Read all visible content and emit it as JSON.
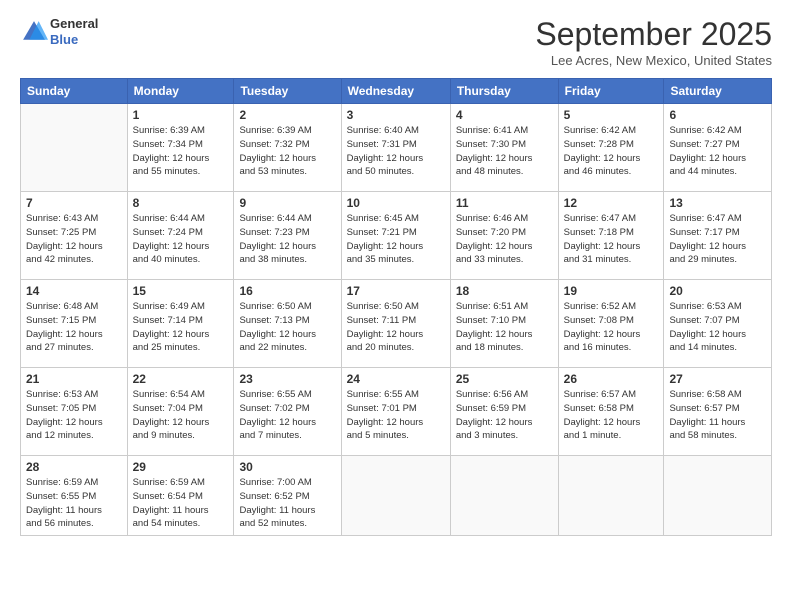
{
  "header": {
    "logo": {
      "general": "General",
      "blue": "Blue"
    },
    "title": "September 2025",
    "location": "Lee Acres, New Mexico, United States"
  },
  "weekdays": [
    "Sunday",
    "Monday",
    "Tuesday",
    "Wednesday",
    "Thursday",
    "Friday",
    "Saturday"
  ],
  "weeks": [
    [
      {
        "day": "",
        "info": ""
      },
      {
        "day": "1",
        "info": "Sunrise: 6:39 AM\nSunset: 7:34 PM\nDaylight: 12 hours\nand 55 minutes."
      },
      {
        "day": "2",
        "info": "Sunrise: 6:39 AM\nSunset: 7:32 PM\nDaylight: 12 hours\nand 53 minutes."
      },
      {
        "day": "3",
        "info": "Sunrise: 6:40 AM\nSunset: 7:31 PM\nDaylight: 12 hours\nand 50 minutes."
      },
      {
        "day": "4",
        "info": "Sunrise: 6:41 AM\nSunset: 7:30 PM\nDaylight: 12 hours\nand 48 minutes."
      },
      {
        "day": "5",
        "info": "Sunrise: 6:42 AM\nSunset: 7:28 PM\nDaylight: 12 hours\nand 46 minutes."
      },
      {
        "day": "6",
        "info": "Sunrise: 6:42 AM\nSunset: 7:27 PM\nDaylight: 12 hours\nand 44 minutes."
      }
    ],
    [
      {
        "day": "7",
        "info": "Sunrise: 6:43 AM\nSunset: 7:25 PM\nDaylight: 12 hours\nand 42 minutes."
      },
      {
        "day": "8",
        "info": "Sunrise: 6:44 AM\nSunset: 7:24 PM\nDaylight: 12 hours\nand 40 minutes."
      },
      {
        "day": "9",
        "info": "Sunrise: 6:44 AM\nSunset: 7:23 PM\nDaylight: 12 hours\nand 38 minutes."
      },
      {
        "day": "10",
        "info": "Sunrise: 6:45 AM\nSunset: 7:21 PM\nDaylight: 12 hours\nand 35 minutes."
      },
      {
        "day": "11",
        "info": "Sunrise: 6:46 AM\nSunset: 7:20 PM\nDaylight: 12 hours\nand 33 minutes."
      },
      {
        "day": "12",
        "info": "Sunrise: 6:47 AM\nSunset: 7:18 PM\nDaylight: 12 hours\nand 31 minutes."
      },
      {
        "day": "13",
        "info": "Sunrise: 6:47 AM\nSunset: 7:17 PM\nDaylight: 12 hours\nand 29 minutes."
      }
    ],
    [
      {
        "day": "14",
        "info": "Sunrise: 6:48 AM\nSunset: 7:15 PM\nDaylight: 12 hours\nand 27 minutes."
      },
      {
        "day": "15",
        "info": "Sunrise: 6:49 AM\nSunset: 7:14 PM\nDaylight: 12 hours\nand 25 minutes."
      },
      {
        "day": "16",
        "info": "Sunrise: 6:50 AM\nSunset: 7:13 PM\nDaylight: 12 hours\nand 22 minutes."
      },
      {
        "day": "17",
        "info": "Sunrise: 6:50 AM\nSunset: 7:11 PM\nDaylight: 12 hours\nand 20 minutes."
      },
      {
        "day": "18",
        "info": "Sunrise: 6:51 AM\nSunset: 7:10 PM\nDaylight: 12 hours\nand 18 minutes."
      },
      {
        "day": "19",
        "info": "Sunrise: 6:52 AM\nSunset: 7:08 PM\nDaylight: 12 hours\nand 16 minutes."
      },
      {
        "day": "20",
        "info": "Sunrise: 6:53 AM\nSunset: 7:07 PM\nDaylight: 12 hours\nand 14 minutes."
      }
    ],
    [
      {
        "day": "21",
        "info": "Sunrise: 6:53 AM\nSunset: 7:05 PM\nDaylight: 12 hours\nand 12 minutes."
      },
      {
        "day": "22",
        "info": "Sunrise: 6:54 AM\nSunset: 7:04 PM\nDaylight: 12 hours\nand 9 minutes."
      },
      {
        "day": "23",
        "info": "Sunrise: 6:55 AM\nSunset: 7:02 PM\nDaylight: 12 hours\nand 7 minutes."
      },
      {
        "day": "24",
        "info": "Sunrise: 6:55 AM\nSunset: 7:01 PM\nDaylight: 12 hours\nand 5 minutes."
      },
      {
        "day": "25",
        "info": "Sunrise: 6:56 AM\nSunset: 6:59 PM\nDaylight: 12 hours\nand 3 minutes."
      },
      {
        "day": "26",
        "info": "Sunrise: 6:57 AM\nSunset: 6:58 PM\nDaylight: 12 hours\nand 1 minute."
      },
      {
        "day": "27",
        "info": "Sunrise: 6:58 AM\nSunset: 6:57 PM\nDaylight: 11 hours\nand 58 minutes."
      }
    ],
    [
      {
        "day": "28",
        "info": "Sunrise: 6:59 AM\nSunset: 6:55 PM\nDaylight: 11 hours\nand 56 minutes."
      },
      {
        "day": "29",
        "info": "Sunrise: 6:59 AM\nSunset: 6:54 PM\nDaylight: 11 hours\nand 54 minutes."
      },
      {
        "day": "30",
        "info": "Sunrise: 7:00 AM\nSunset: 6:52 PM\nDaylight: 11 hours\nand 52 minutes."
      },
      {
        "day": "",
        "info": ""
      },
      {
        "day": "",
        "info": ""
      },
      {
        "day": "",
        "info": ""
      },
      {
        "day": "",
        "info": ""
      }
    ]
  ]
}
